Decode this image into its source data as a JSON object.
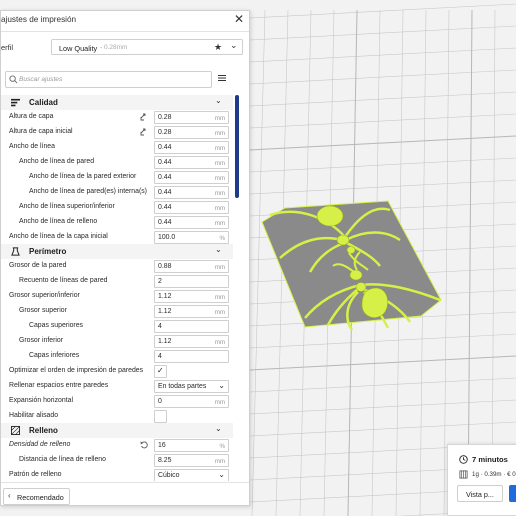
{
  "panel": {
    "title": "ajustes de impresión",
    "profile_label": "erfil",
    "profile_name": "Low Quality",
    "profile_sub": "- 0.28mm",
    "search_placeholder": "Buscar ajustes",
    "recommended_label": "Recomendado",
    "grip": "..."
  },
  "categories": {
    "calidad": "Calidad",
    "perimetro": "Perímetro",
    "relleno": "Relleno"
  },
  "rows": [
    {
      "label": "Altura de capa",
      "value": "0.28",
      "unit": "mm"
    },
    {
      "label": "Altura de capa inicial",
      "value": "0.28",
      "unit": "mm"
    },
    {
      "label": "Ancho de línea",
      "value": "0.44",
      "unit": "mm"
    },
    {
      "label": "Ancho de línea de pared",
      "value": "0.44",
      "unit": "mm"
    },
    {
      "label": "Ancho de línea de la pared exterior",
      "value": "0.44",
      "unit": "mm"
    },
    {
      "label": "Ancho de línea de pared(es) interna(s)",
      "value": "0.44",
      "unit": "mm"
    },
    {
      "label": "Ancho de línea superior/inferior",
      "value": "0.44",
      "unit": "mm"
    },
    {
      "label": "Ancho de línea de relleno",
      "value": "0.44",
      "unit": "mm"
    },
    {
      "label": "Ancho de línea de la capa inicial",
      "value": "100.0",
      "unit": "%"
    },
    {
      "label": "Grosor de la pared",
      "value": "0.88",
      "unit": "mm"
    },
    {
      "label": "Recuento de líneas de pared",
      "value": "2",
      "unit": ""
    },
    {
      "label": "Grosor superior/inferior",
      "value": "1.12",
      "unit": "mm"
    },
    {
      "label": "Grosor superior",
      "value": "1.12",
      "unit": "mm"
    },
    {
      "label": "Capas superiores",
      "value": "4",
      "unit": ""
    },
    {
      "label": "Grosor inferior",
      "value": "1.12",
      "unit": "mm"
    },
    {
      "label": "Capas inferiores",
      "value": "4",
      "unit": ""
    },
    {
      "label": "Optimizar el orden de impresión de paredes",
      "checked": true
    },
    {
      "label": "Rellenar espacios entre paredes",
      "value": "En todas partes"
    },
    {
      "label": "Expansión horizontal",
      "value": "0",
      "unit": "mm"
    },
    {
      "label": "Habilitar alisado",
      "checked": false
    },
    {
      "label": "Densidad de relleno",
      "value": "16",
      "unit": "%"
    },
    {
      "label": "Distancia de línea de relleno",
      "value": "8.25",
      "unit": "mm"
    },
    {
      "label": "Patrón de relleno",
      "value": "Cúbico"
    }
  ],
  "print_card": {
    "time": "7 minutos",
    "material": "1g · 0.39m · € 0",
    "preview_label": "Vista p..."
  },
  "colors": {
    "accent": "#1e3a8a",
    "model": "#d6f048",
    "build_plate": "#808080",
    "slice_button": "#1e6be0"
  }
}
